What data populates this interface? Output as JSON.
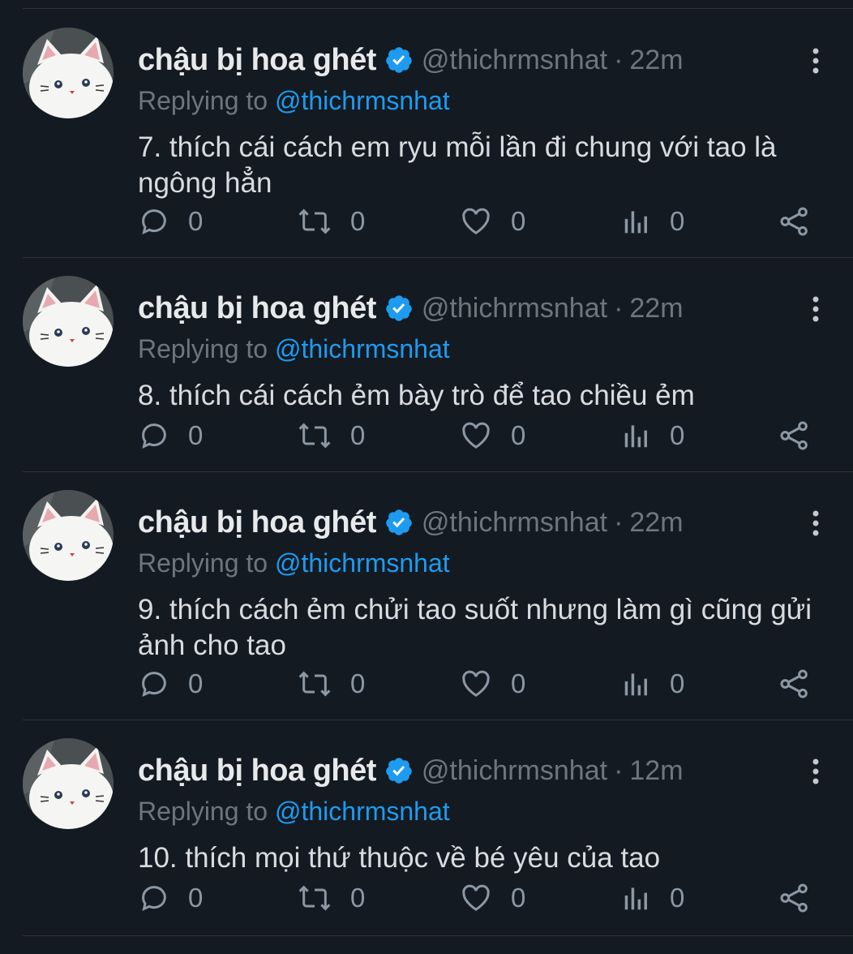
{
  "colors": {
    "background": "#141a21",
    "name": "#e7e9ea",
    "muted": "#6e767d",
    "mention": "#1d9bf0",
    "verified": "#1d9bf0",
    "divider": "#2f3336"
  },
  "tweets": [
    {
      "display_name": "chậu bị hoa ghét",
      "handle": "@thichrmsnhat",
      "time": "22m",
      "replying_prefix": "Replying to",
      "replying_to": "@thichrmsnhat",
      "text": "7. thích cái cách em ryu mỗi lần đi chung với tao là ngông hẳn",
      "replies": "0",
      "retweets": "0",
      "likes": "0",
      "views": "0"
    },
    {
      "display_name": "chậu bị hoa ghét",
      "handle": "@thichrmsnhat",
      "time": "22m",
      "replying_prefix": "Replying to",
      "replying_to": "@thichrmsnhat",
      "text": "8. thích cái cách ẻm bày trò để tao chiều ẻm",
      "replies": "0",
      "retweets": "0",
      "likes": "0",
      "views": "0"
    },
    {
      "display_name": "chậu bị hoa ghét",
      "handle": "@thichrmsnhat",
      "time": "22m",
      "replying_prefix": "Replying to",
      "replying_to": "@thichrmsnhat",
      "text": "9. thích cách ẻm chửi tao suốt nhưng làm gì cũng gửi ảnh cho tao",
      "replies": "0",
      "retweets": "0",
      "likes": "0",
      "views": "0"
    },
    {
      "display_name": "chậu bị hoa ghét",
      "handle": "@thichrmsnhat",
      "time": "12m",
      "replying_prefix": "Replying to",
      "replying_to": "@thichrmsnhat",
      "text": "10. thích mọi thứ thuộc về bé yêu của tao",
      "replies": "0",
      "retweets": "0",
      "likes": "0",
      "views": "0"
    }
  ],
  "separator_dot": "·",
  "icons": {
    "reply": "reply-icon",
    "retweet": "retweet-icon",
    "like": "heart-icon",
    "views": "views-icon",
    "share": "share-icon",
    "more": "more-icon",
    "verified": "verified-badge-icon"
  }
}
